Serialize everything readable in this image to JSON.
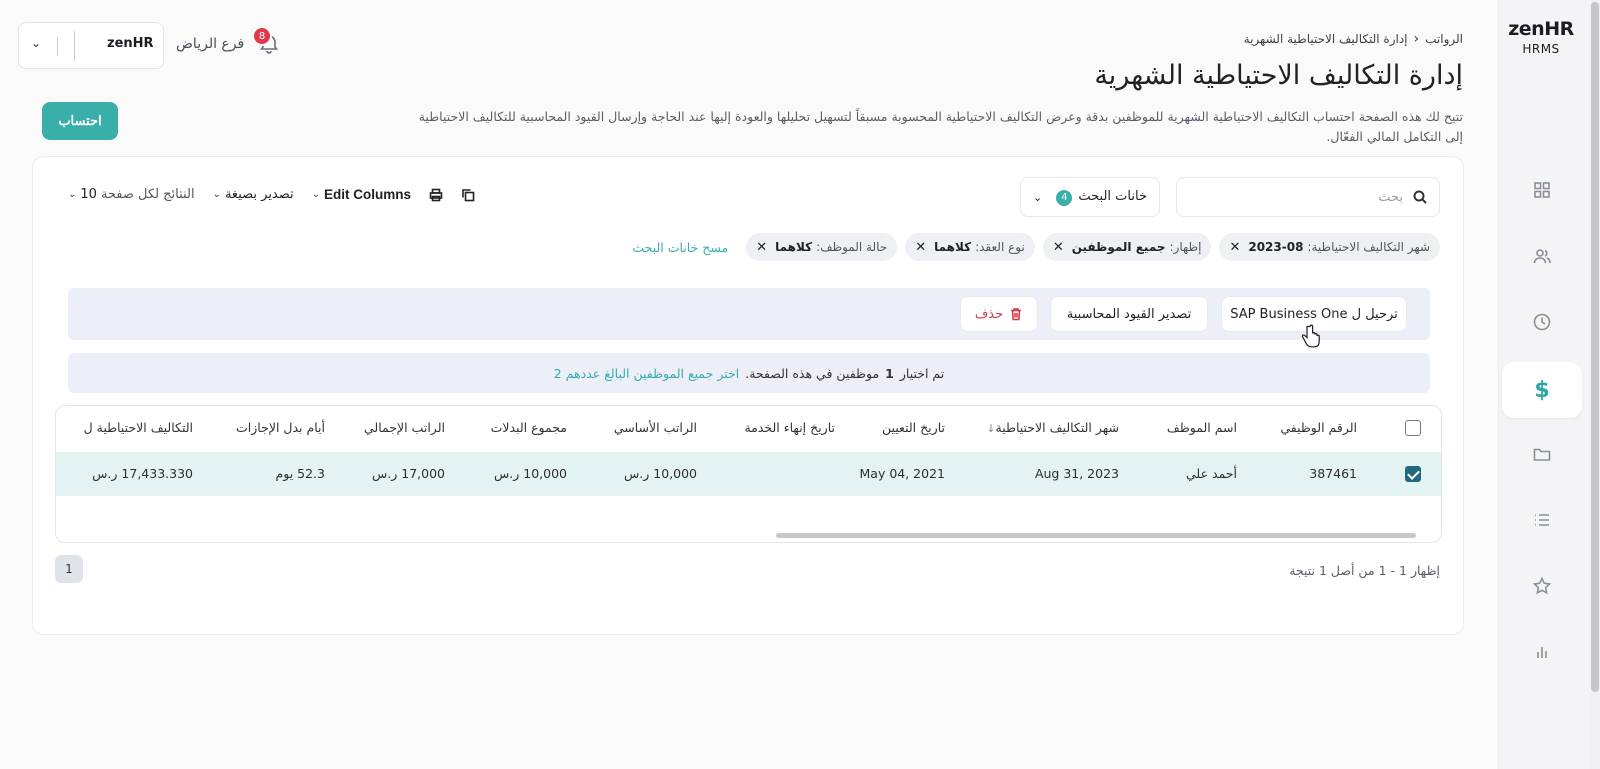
{
  "sidebar": {
    "brand": "zenHR",
    "brand_sub": "HRMS",
    "items": [
      {
        "icon": "dashboard-grid-icon"
      },
      {
        "icon": "users-icon"
      },
      {
        "icon": "clock-icon"
      },
      {
        "icon": "dollar-icon",
        "glyph": "$",
        "active": true
      },
      {
        "icon": "folder-icon"
      },
      {
        "icon": "list-icon"
      },
      {
        "icon": "star-icon"
      },
      {
        "icon": "bar-chart-icon"
      }
    ]
  },
  "header": {
    "breadcrumb_root": "الرواتب",
    "breadcrumb_current": "إدارة التكاليف الاحتياطية الشهرية",
    "title": "إدارة التكاليف الاحتياطية الشهرية",
    "description": "تتيح لك هذه الصفحة احتساب التكاليف الاحتياطية الشهرية للموظفين بدقة وعرض التكاليف الاحتياطية المحسوبة مسبقاً لتسهيل تحليلها والعودة إليها عند الحاجة وإرسال القيود المحاسبية للتكاليف الاحتياطية إلى التكامل المالي الفعّال.",
    "branch": "فرع الرياض",
    "notifications_count": "8",
    "company_logo_text": "zenHR",
    "calculate_button": "احتساب"
  },
  "toolbar": {
    "search_placeholder": "بحث",
    "search_fields_label": "خانات البحث",
    "search_fields_count": "4",
    "edit_columns": "Edit Columns",
    "export_format": "تصدير بصيغة",
    "per_page_label": "النتائج لكل صفحة",
    "per_page_value": "10"
  },
  "filters": {
    "chips": [
      {
        "key": "شهر التكاليف الاحتياطية:",
        "value": "2023-08"
      },
      {
        "key": "إظهار:",
        "value": "جميع الموظفين"
      },
      {
        "key": "نوع العقد:",
        "value": "كلاهما"
      },
      {
        "key": "حالة الموظف:",
        "value": "كلاهما"
      }
    ],
    "clear": "مسح خانات البحث"
  },
  "actions": {
    "sap": "ترحيل ل SAP Business One",
    "export_entries": "تصدير القيود المحاسبية",
    "delete": "حذف"
  },
  "selection": {
    "prefix": "تم اختيار",
    "count": "1",
    "suffix": "موظفين في هذه الصفحة.",
    "select_all": "اختر جميع الموظفين البالغ عددهم 2"
  },
  "table": {
    "columns": [
      "الرقم الوظيفي",
      "اسم الموظف",
      "شهر التكاليف الاحتياطية",
      "تاريخ التعيين",
      "تاريخ إنهاء الخدمة",
      "الراتب الأساسي",
      "مجموع البدلات",
      "الراتب الإجمالي",
      "أيام بدل الإجازات",
      "التكاليف الاحتياطية ل"
    ],
    "rows": [
      [
        "387461",
        "أحمد علي",
        "Aug 31, 2023",
        "May 04, 2021",
        "",
        "10,000 ر.س",
        "10,000 ر.س",
        "17,000 ر.س",
        "52.3 يوم",
        "17,433.330 ر.س"
      ]
    ]
  },
  "pagination": {
    "current_page": "1",
    "summary": "إظهار 1 - 1 من أصل 1 نتيجة"
  },
  "colors": {
    "accent": "#3aaea9",
    "danger": "#d83a4a",
    "selected_row": "#e3f3f1"
  }
}
